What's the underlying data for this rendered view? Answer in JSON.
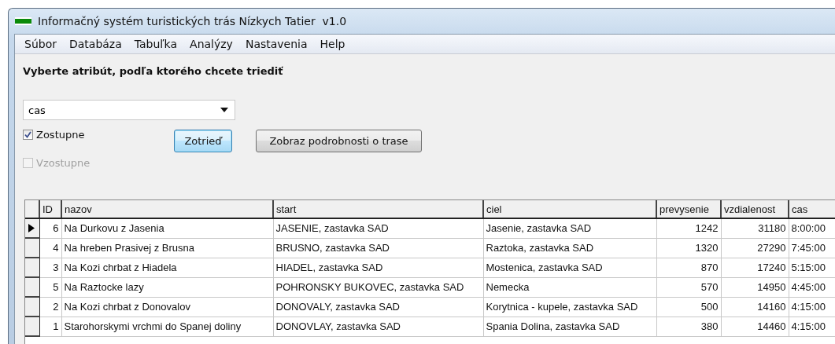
{
  "window": {
    "title": "Informačný systém turistických trás Nízkych Tatier  v1.0"
  },
  "menu": [
    "Súbor",
    "Databáza",
    "Tabuľka",
    "Analýzy",
    "Nastavenia",
    "Help"
  ],
  "sort_panel": {
    "prompt": "Vyberte atribút, podľa ktorého chcete triediť",
    "attribute": "cas",
    "options": [
      {
        "label": "Zostupne",
        "checked": true,
        "disabled": false
      },
      {
        "label": "Vzostupne",
        "checked": false,
        "disabled": true
      }
    ],
    "buttons": [
      {
        "label": "Zotrieď",
        "focused": true
      },
      {
        "label": "Zobraz podrobnosti o trase",
        "focused": false
      }
    ]
  },
  "table": {
    "columns": [
      {
        "label": "ID",
        "kind": "number"
      },
      {
        "label": "nazov",
        "kind": "text"
      },
      {
        "label": "start",
        "kind": "text"
      },
      {
        "label": "ciel",
        "kind": "text"
      },
      {
        "label": "prevysenie",
        "kind": "number"
      },
      {
        "label": "vzdialenost",
        "kind": "number"
      },
      {
        "label": "cas",
        "kind": "text"
      }
    ],
    "rows": [
      {
        "selected": true,
        "cells": [
          "6",
          "Na Durkovu z Jasenia",
          "JASENIE, zastavka SAD",
          "Jasenie, zastavka SAD",
          "1242",
          "31180",
          "8:00:00"
        ]
      },
      {
        "selected": false,
        "cells": [
          "4",
          "Na hreben Prasivej z Brusna",
          "BRUSNO, zastavka SAD",
          "Raztoka, zastavka SAD",
          "1320",
          "27290",
          "7:45:00"
        ]
      },
      {
        "selected": false,
        "cells": [
          "3",
          "Na Kozi chrbat z Hiadela",
          "HIADEL, zastavka SAD",
          "Mostenica, zastavka SAD",
          "870",
          "17240",
          "5:15:00"
        ]
      },
      {
        "selected": false,
        "cells": [
          "5",
          "Na Raztocke lazy",
          "POHRONSKY BUKOVEC, zastavka SAD",
          "Nemecka",
          "570",
          "14950",
          "4:45:00"
        ]
      },
      {
        "selected": false,
        "cells": [
          "2",
          "Na Kozi chrbat z Donovalov",
          "DONOVALY, zastavka SAD",
          "Korytnica - kupele, zastavka SAD",
          "500",
          "14160",
          "4:15:00"
        ]
      },
      {
        "selected": false,
        "cells": [
          "1",
          "Starohorskymi vrchmi  do Spanej doliny",
          "DONOVLAY, zastavka SAD",
          "Spania Dolina, zastavka SAD",
          "380",
          "14460",
          "4:15:00"
        ]
      }
    ]
  }
}
